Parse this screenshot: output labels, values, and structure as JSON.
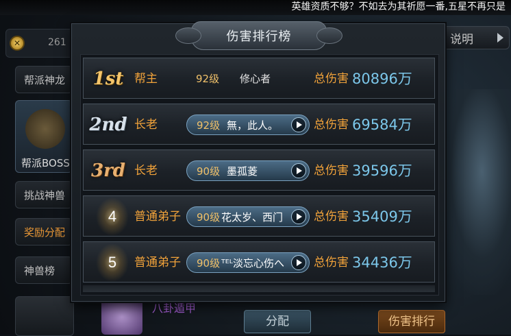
{
  "marquee": "英雄资质不够？不如去为其祈愿一番,五星不再只是",
  "background": {
    "coin_value": "261",
    "help_label": "说明",
    "side_tabs": [
      "帮派神龙",
      "帮派BOSS",
      "挑战神兽",
      "奖励分配",
      "神兽榜"
    ],
    "item_name": "八卦遁甲",
    "assign_button": "分配",
    "rank_button": "伤害排行"
  },
  "modal": {
    "title": "伤害排行榜",
    "damage_label": "总伤害",
    "rows": [
      {
        "rank": "1st",
        "role": "帮主",
        "level": "92级",
        "name": "修心者",
        "damage": "80896万"
      },
      {
        "rank": "2nd",
        "role": "长老",
        "level": "92级",
        "name": "無，此人。",
        "damage": "69584万"
      },
      {
        "rank": "3rd",
        "role": "长老",
        "level": "90级",
        "name": "墨孤菱",
        "damage": "39596万"
      },
      {
        "rank": "4",
        "role": "普通弟子",
        "level": "90级",
        "name": "花太岁、西门",
        "damage": "35409万"
      },
      {
        "rank": "5",
        "role": "普通弟子",
        "level": "90级",
        "name": "ᵀᴱᴸ淡忘心伤へ",
        "damage": "34436万"
      }
    ]
  },
  "colors": {
    "gold": "#f4c56a",
    "orange_label": "#f2a33a",
    "damage_blue": "#7cc7ea",
    "pill_blue": "#4c6c86"
  }
}
